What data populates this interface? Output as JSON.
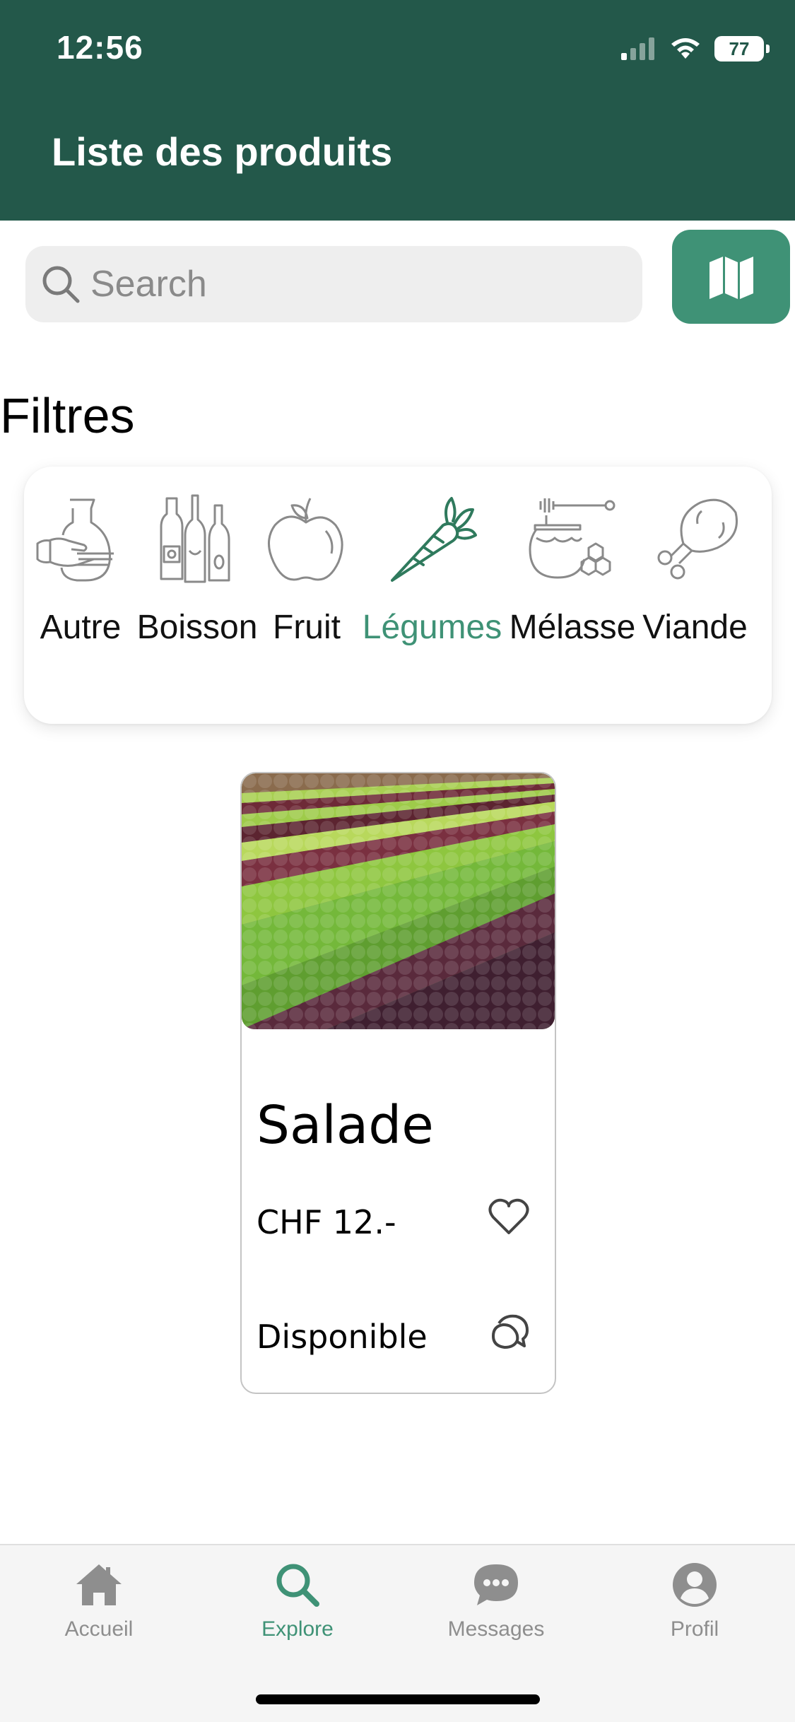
{
  "status_bar": {
    "time": "12:56",
    "battery": "77",
    "icons": [
      "signal-icon",
      "wifi-icon",
      "battery-icon"
    ]
  },
  "header": {
    "title": "Liste des produits"
  },
  "search": {
    "placeholder": "Search",
    "value": "",
    "icon": "search-icon"
  },
  "map_button": {
    "icon": "map-icon"
  },
  "filters": {
    "heading": "Filtres",
    "items": [
      {
        "label": "Autre",
        "icon": "pitcher-icon",
        "active": false
      },
      {
        "label": "Boisson",
        "icon": "bottles-icon",
        "active": false
      },
      {
        "label": "Fruit",
        "icon": "apple-icon",
        "active": false
      },
      {
        "label": "Légumes",
        "icon": "carrot-icon",
        "active": true
      },
      {
        "label": "Mélasse",
        "icon": "honey-icon",
        "active": false
      },
      {
        "label": "Viande",
        "icon": "drumstick-icon",
        "active": false
      }
    ]
  },
  "product": {
    "name": "Salade",
    "price": "CHF 12.-",
    "availability": "Disponible",
    "image": "lettuce-field-image",
    "icons": [
      "heart-icon",
      "chat-icon"
    ]
  },
  "tabs": [
    {
      "label": "Accueil",
      "icon": "home-icon",
      "active": false
    },
    {
      "label": "Explore",
      "icon": "search-icon",
      "active": true
    },
    {
      "label": "Messages",
      "icon": "chat-bubble-icon",
      "active": false
    },
    {
      "label": "Profil",
      "icon": "profile-icon",
      "active": false
    }
  ],
  "colors": {
    "header": "#23584a",
    "accent": "#3f9276",
    "inactive": "#8e8e8e"
  }
}
